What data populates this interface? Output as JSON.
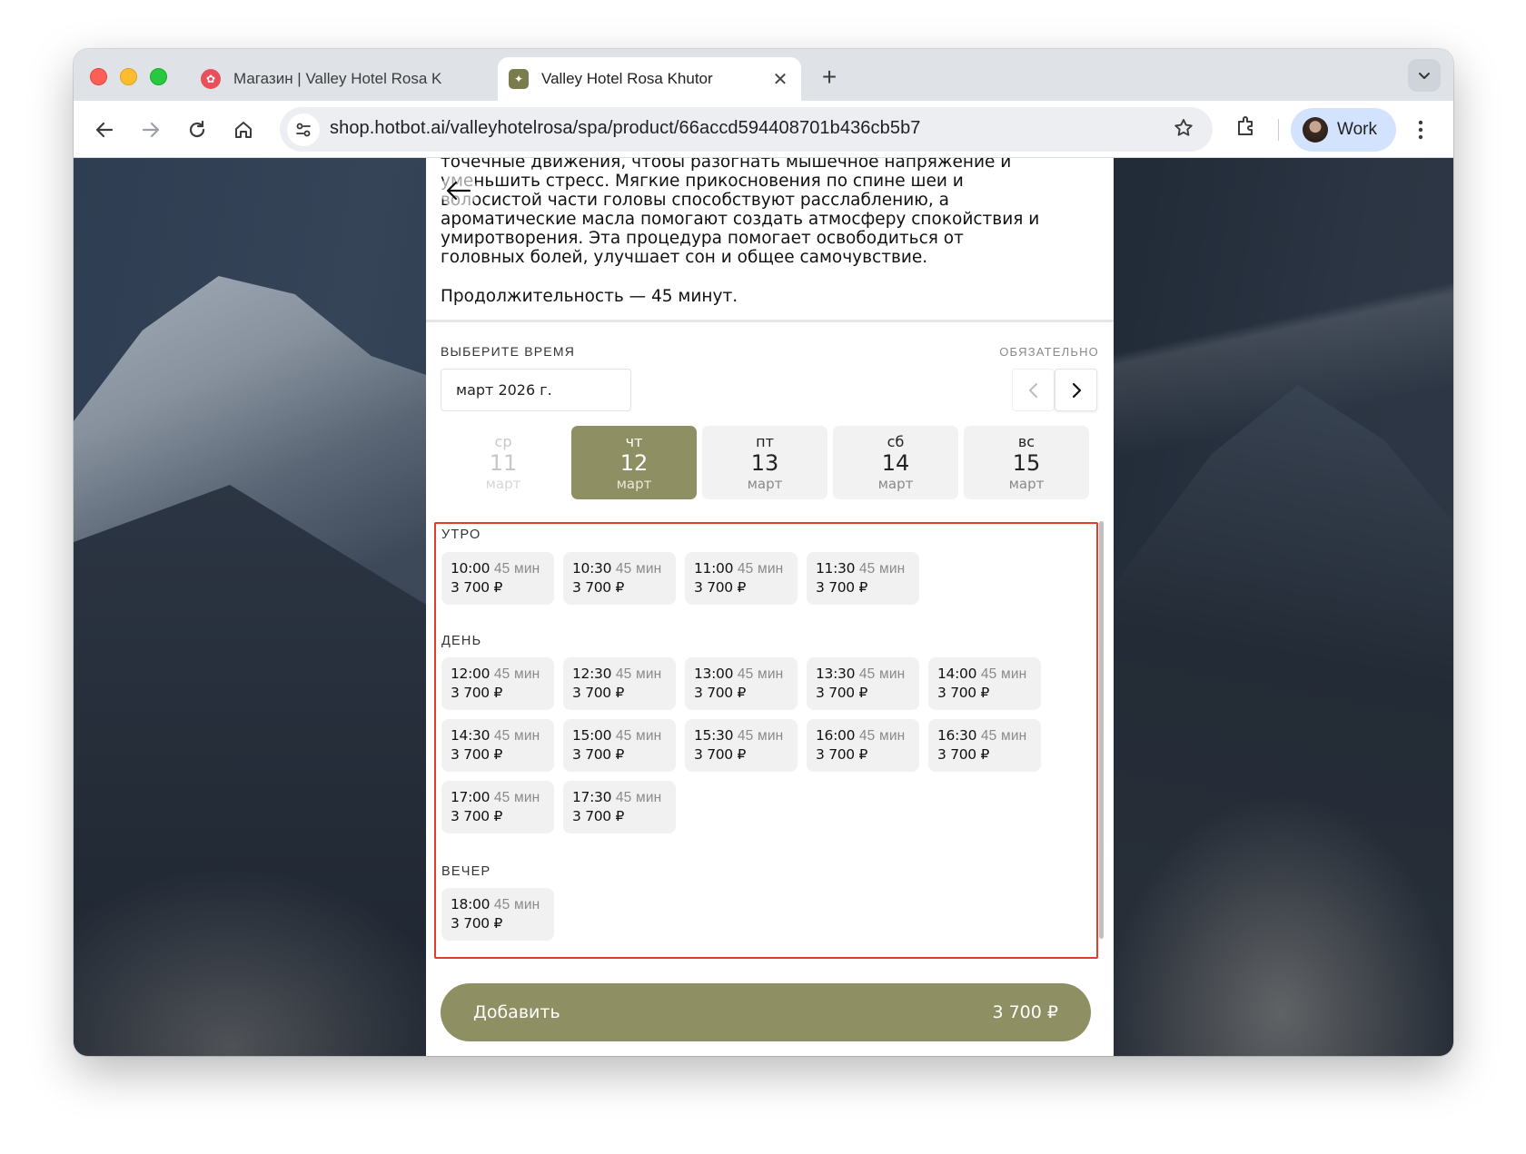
{
  "browser": {
    "tabs": [
      {
        "title": "Магазин | Valley Hotel Rosa K",
        "close": "✕"
      },
      {
        "title": "Valley Hotel Rosa Khutor",
        "close": "✕"
      }
    ],
    "new_tab": "+",
    "url": "shop.hotbot.ai/valleyhotelrosa/spa/product/66accd594408701b436cb5b7",
    "profile_name": "Work"
  },
  "product": {
    "description": "точечные движения, чтобы разогнать мышечное напряжение и\nуменьшить стресс. Мягкие прикосновения по спине шеи и\nволосистой части головы способствуют расслаблению, а\nароматические масла помогают создать атмосферу спокойствия и\nумиротворения. Эта процедура помогает освободиться от\nголовных болей, улучшает сон и общее самочувствие.",
    "duration": "Продолжительность — 45 минут."
  },
  "booking": {
    "section_label": "ВЫБЕРИТЕ ВРЕМЯ",
    "required_label": "ОБЯЗАТЕЛЬНО",
    "month": "март 2026 г.",
    "days": [
      {
        "weekday": "ср",
        "date": "11",
        "month": "март",
        "state": "disabled"
      },
      {
        "weekday": "чт",
        "date": "12",
        "month": "март",
        "state": "selected"
      },
      {
        "weekday": "пт",
        "date": "13",
        "month": "март",
        "state": "available"
      },
      {
        "weekday": "сб",
        "date": "14",
        "month": "март",
        "state": "available"
      },
      {
        "weekday": "вс",
        "date": "15",
        "month": "март",
        "state": "available"
      }
    ],
    "groups": [
      {
        "title": "УТРО",
        "slots": [
          {
            "time": "10:00",
            "duration": "45 мин",
            "price": "3 700 ₽"
          },
          {
            "time": "10:30",
            "duration": "45 мин",
            "price": "3 700 ₽"
          },
          {
            "time": "11:00",
            "duration": "45 мин",
            "price": "3 700 ₽"
          },
          {
            "time": "11:30",
            "duration": "45 мин",
            "price": "3 700 ₽"
          }
        ]
      },
      {
        "title": "ДЕНЬ",
        "slots": [
          {
            "time": "12:00",
            "duration": "45 мин",
            "price": "3 700 ₽"
          },
          {
            "time": "12:30",
            "duration": "45 мин",
            "price": "3 700 ₽"
          },
          {
            "time": "13:00",
            "duration": "45 мин",
            "price": "3 700 ₽"
          },
          {
            "time": "13:30",
            "duration": "45 мин",
            "price": "3 700 ₽"
          },
          {
            "time": "14:00",
            "duration": "45 мин",
            "price": "3 700 ₽"
          },
          {
            "time": "14:30",
            "duration": "45 мин",
            "price": "3 700 ₽"
          },
          {
            "time": "15:00",
            "duration": "45 мин",
            "price": "3 700 ₽"
          },
          {
            "time": "15:30",
            "duration": "45 мин",
            "price": "3 700 ₽"
          },
          {
            "time": "16:00",
            "duration": "45 мин",
            "price": "3 700 ₽"
          },
          {
            "time": "16:30",
            "duration": "45 мин",
            "price": "3 700 ₽"
          },
          {
            "time": "17:00",
            "duration": "45 мин",
            "price": "3 700 ₽"
          },
          {
            "time": "17:30",
            "duration": "45 мин",
            "price": "3 700 ₽"
          }
        ]
      },
      {
        "title": "ВЕЧЕР",
        "slots": [
          {
            "time": "18:00",
            "duration": "45 мин",
            "price": "3 700 ₽"
          }
        ]
      }
    ],
    "add_button": {
      "label": "Добавить",
      "price": "3 700 ₽"
    }
  },
  "colors": {
    "accent": "#8e9064",
    "highlight_border": "#e23c2c",
    "slot_bg": "#f1f1f1"
  },
  "icons": [
    "back-arrow-icon",
    "forward-arrow-icon",
    "reload-icon",
    "home-icon",
    "site-settings-icon",
    "star-icon",
    "extensions-icon",
    "kebab-menu-icon",
    "chevron-left-icon",
    "chevron-right-icon",
    "tab-list-icon"
  ]
}
